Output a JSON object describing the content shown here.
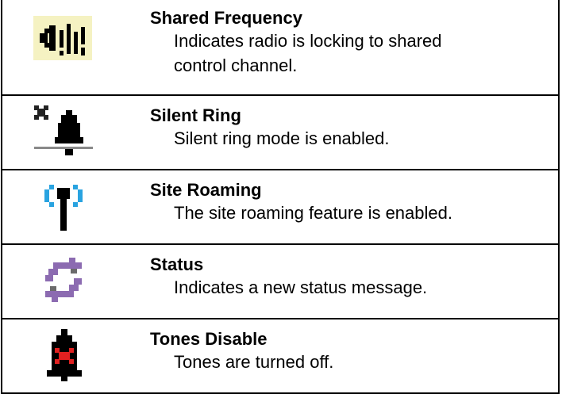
{
  "rows": [
    {
      "icon": "shared-frequency-icon",
      "title": "Shared Frequency",
      "desc_lines": [
        "Indicates radio is locking to shared",
        "control channel."
      ]
    },
    {
      "icon": "silent-ring-icon",
      "title": "Silent Ring",
      "desc_lines": [
        "Silent ring mode is enabled."
      ]
    },
    {
      "icon": "site-roaming-icon",
      "title": "Site Roaming",
      "desc_lines": [
        "The site roaming feature is enabled."
      ]
    },
    {
      "icon": "status-icon",
      "title": "Status",
      "desc_lines": [
        "Indicates a new status message."
      ]
    },
    {
      "icon": "tones-disable-icon",
      "title": "Tones Disable",
      "desc_lines": [
        "Tones are turned off."
      ]
    }
  ],
  "colors": {
    "icon_highlight_bg": "#f5f2c2",
    "roaming_blue": "#29a3e0",
    "status_purple": "#8c6bb1",
    "status_gray": "#6b6b6b",
    "tones_red": "#e02020",
    "ring_gray": "#888888"
  }
}
